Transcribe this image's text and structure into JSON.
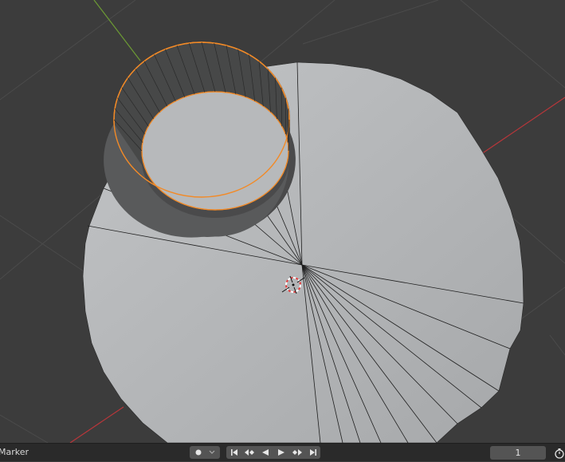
{
  "viewport": {
    "icons": {
      "cursor": "3d-cursor-icon",
      "object": "cylinder-mesh",
      "ground": "circle-mesh"
    },
    "colors": {
      "background": "#3c3c3c",
      "grid": "#4a4a4a",
      "x_axis": "#c33c3c",
      "y_axis": "#7aa53a",
      "selection": "#f5922e",
      "mesh_face": "#b2b4b6"
    }
  },
  "timeline": {
    "marker_label": "Marker",
    "keying_icon": "record-dot-icon",
    "keying_dropdown_icon": "chevron-down-icon",
    "playback_icons": [
      "jump-to-start-icon",
      "jump-to-previous-keyframe-icon",
      "play-reverse-icon",
      "play-icon",
      "jump-to-next-keyframe-icon",
      "jump-to-end-icon"
    ],
    "current_frame": "1",
    "timer_icon": "stopwatch-icon"
  }
}
